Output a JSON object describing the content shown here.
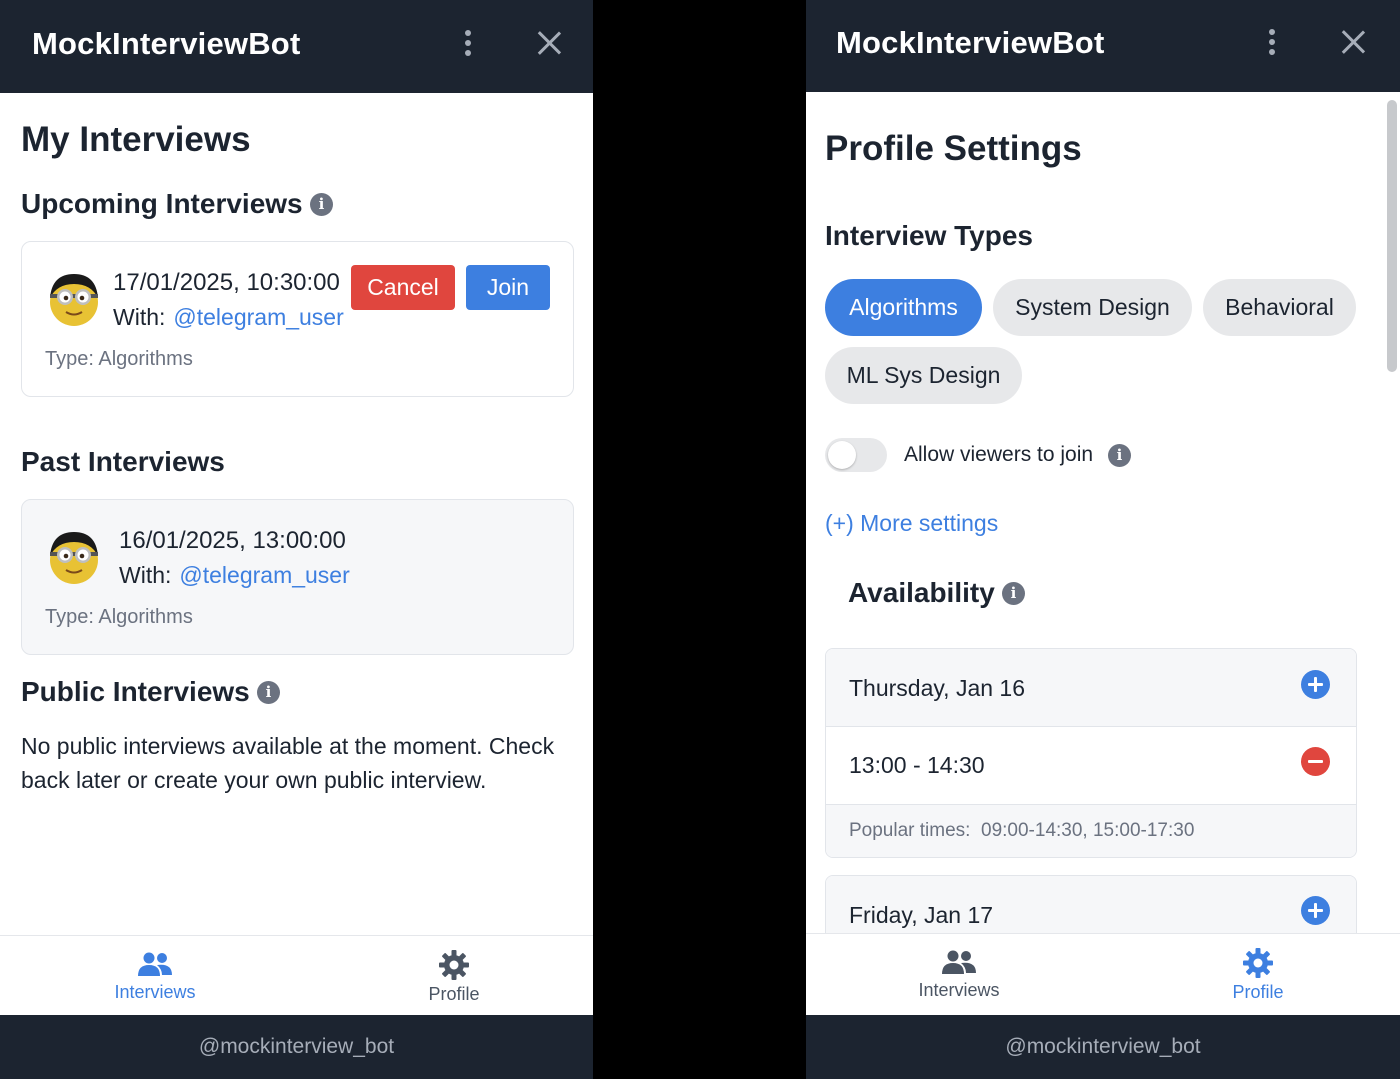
{
  "app": {
    "title": "MockInterviewBot",
    "footer": "@mockinterview_bot"
  },
  "left": {
    "page_title": "My Interviews",
    "upcoming": {
      "heading": "Upcoming Interviews",
      "items": [
        {
          "datetime": "17/01/2025, 10:30:00",
          "with_label": "With:",
          "user": "@telegram_user",
          "type": "Type: Algorithms",
          "cancel_label": "Cancel",
          "join_label": "Join"
        }
      ]
    },
    "past": {
      "heading": "Past Interviews",
      "items": [
        {
          "datetime": "16/01/2025, 13:00:00",
          "with_label": "With:",
          "user": "@telegram_user",
          "type": "Type: Algorithms"
        }
      ]
    },
    "public": {
      "heading": "Public Interviews",
      "empty_text": "No public interviews available at the moment. Check back later or create your own public interview."
    }
  },
  "right": {
    "page_title": "Profile Settings",
    "types_heading": "Interview Types",
    "chips": [
      {
        "label": "Algorithms",
        "selected": true
      },
      {
        "label": "System Design",
        "selected": false
      },
      {
        "label": "Behavioral",
        "selected": false
      },
      {
        "label": "ML Sys Design",
        "selected": false
      }
    ],
    "viewers_toggle": {
      "label": "Allow viewers to join",
      "on": false
    },
    "more_settings": "(+) More settings",
    "availability": {
      "heading": "Availability",
      "days": [
        {
          "day": "Thursday, Jan 16",
          "slots": [
            "13:00 - 14:30"
          ],
          "popular_label": "Popular times:",
          "popular": "09:00-14:30, 15:00-17:30"
        },
        {
          "day": "Friday, Jan 17"
        }
      ]
    }
  },
  "nav": {
    "items": [
      {
        "label": "Interviews",
        "icon": "people-icon"
      },
      {
        "label": "Profile",
        "icon": "gear-icon"
      }
    ]
  },
  "colors": {
    "accent": "#3d7fe0",
    "danger": "#e0463e",
    "header": "#1c2430",
    "inactive": "#4b5563"
  }
}
